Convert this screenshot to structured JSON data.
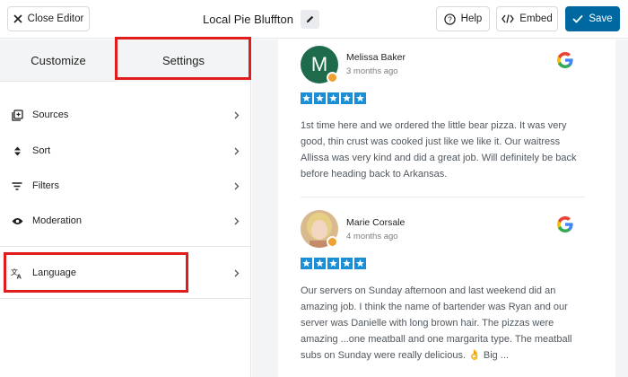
{
  "header": {
    "close_label": "Close Editor",
    "title": "Local Pie Bluffton",
    "help_label": "Help",
    "embed_label": "Embed",
    "save_label": "Save"
  },
  "tabs": [
    {
      "label": "Customize"
    },
    {
      "label": "Settings"
    }
  ],
  "menu": [
    {
      "label": "Sources",
      "icon": "sources-icon"
    },
    {
      "label": "Sort",
      "icon": "sort-icon"
    },
    {
      "label": "Filters",
      "icon": "filter-icon"
    },
    {
      "label": "Moderation",
      "icon": "eye-icon"
    },
    {
      "label": "Language",
      "icon": "translate-icon"
    }
  ],
  "reviews": [
    {
      "author": "Melissa Baker",
      "initial": "M",
      "time": "3 months ago",
      "rating": 5,
      "text": "1st time here and we ordered the little bear pizza. It was very good, thin crust was cooked just like we like it. Our waitress Allissa was very kind and did a great job. Will definitely be back before heading back to Arkansas."
    },
    {
      "author": "Marie Corsale",
      "time": "4 months ago",
      "rating": 5,
      "text": "Our servers on Sunday afternoon and last weekend did an amazing job. I think the name of bartender was Ryan and our server was Danielle with long brown hair. The pizzas were amazing ...one meatball and one margarita type. The meatball subs on Sunday were really delicious. 👌 Big ..."
    }
  ],
  "colors": {
    "accent": "#0068a0",
    "highlight": "#e01c1c",
    "star": "#1a8fd6",
    "avatar_bg": "#1e6b4c"
  }
}
